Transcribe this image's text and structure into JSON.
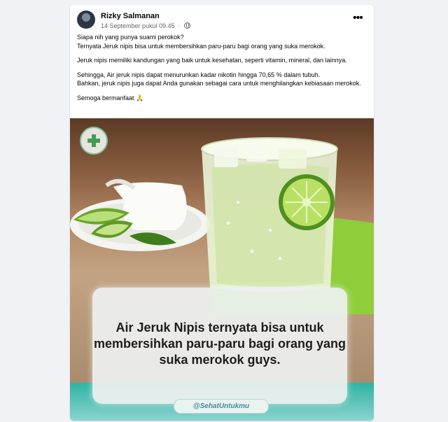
{
  "post": {
    "author": "Rizky Salmanan",
    "timestamp": "14 September pukul 09.45",
    "paragraphs": [
      "Siapa nih yang punya suami perokok?\nTernyata Jeruk nipis bisa untuk membersihkan paru-paru bagi orang yang suka merokok.",
      "Jeruk nipis memiliki kandungan yang baik untuk kesehatan, seperti vitamin, mineral, dan lainnya.",
      "Sehingga, Air jeruk nipis dapat menurunkan kadar nikotin hingga 70,65 % dalam tubuh.\nBahkan, jeruk nipis juga dapat Anda gunakan sebagai cara untuk menghilangkan kebiasaan merokok.",
      "Semoga bermanfaat 🙏"
    ]
  },
  "image": {
    "caption": "Air Jeruk Nipis ternyata bisa untuk membersihkan paru-paru bagi orang yang suka merokok guys.",
    "handle": "@SehatUntukmu"
  },
  "icons": {
    "more": "more-options-icon",
    "audience": "globe-icon",
    "logo": "health-logo"
  },
  "colors": {
    "page_background": "#f0f2f5",
    "card": "#ffffff",
    "lime": "#8fce3a",
    "teal_band": "#2db3a3"
  }
}
